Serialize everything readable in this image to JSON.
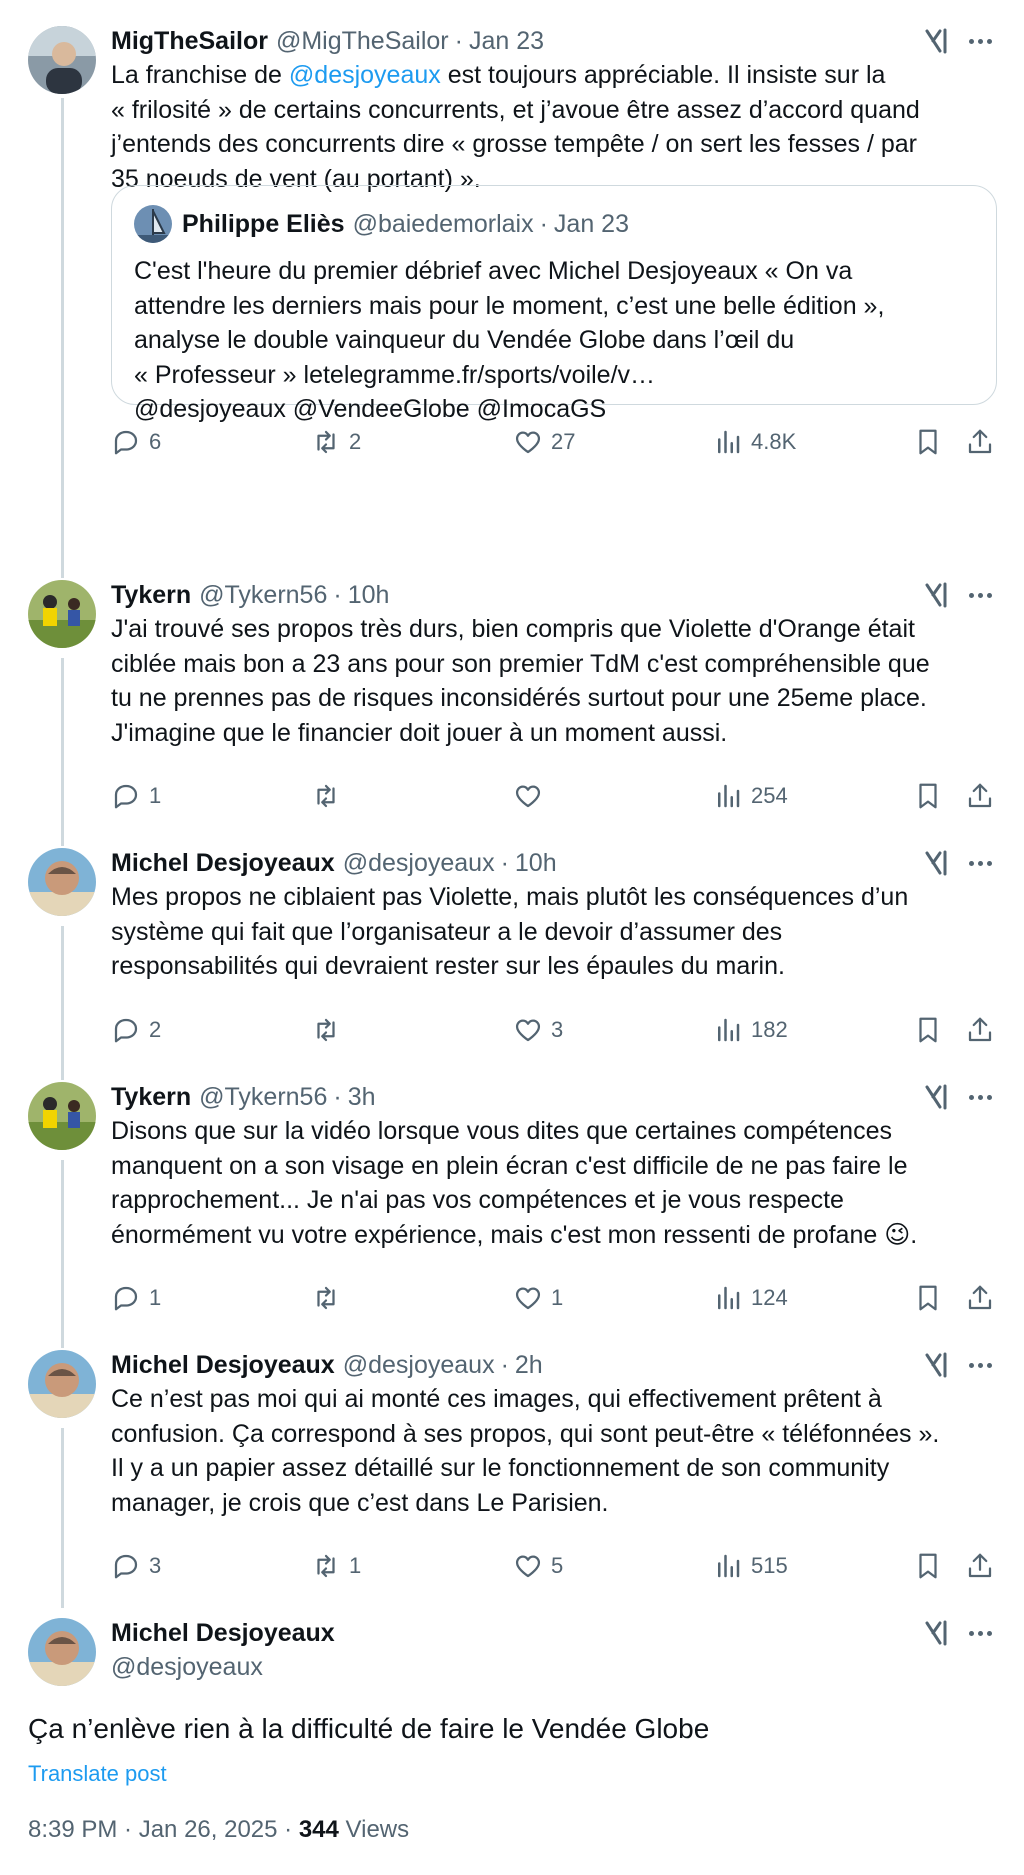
{
  "posts": [
    {
      "name": "MigTheSailor",
      "handle": "@MigTheSailor",
      "time": "Jan 23",
      "body_lines": [
        [
          "La franchise de ",
          "@desjoyeaux",
          " est toujours appréciable. Il insiste sur la"
        ],
        "« frilosité » de certains concurrents, et j’avoue être assez d’accord quand",
        "j’entends des concurrents dire « grosse tempête / on sert les fesses / par",
        "35 noeuds de vent (au portant) »."
      ],
      "quote": {
        "name": "Philippe Eliès",
        "handle": "@baiedemorlaix",
        "time": "Jan 23",
        "lines": [
          "C'est l'heure du premier débrief avec Michel Desjoyeaux « On va",
          "attendre les derniers mais pour le moment, c’est une belle édition »,",
          "analyse le double vainqueur du Vendée Globe dans l’œil du",
          "« Professeur »  letelegramme.fr/sports/voile/v…",
          "@desjoyeaux @VendeeGlobe @ImocaGS"
        ]
      },
      "replies": "6",
      "reposts": "2",
      "likes": "27",
      "views": "4.8K"
    },
    {
      "name": "Tykern",
      "handle": "@Tykern56",
      "time": "10h",
      "body_lines": [
        "J'ai trouvé ses propos très durs, bien compris que Violette d'Orange était",
        "ciblée mais bon a 23 ans pour son premier TdM c'est compréhensible que",
        "tu ne prennes pas de risques inconsidérés surtout pour une 25eme place.",
        "J'imagine que le financier doit jouer à un moment aussi."
      ],
      "replies": "1",
      "reposts": "",
      "likes": "",
      "views": "254"
    },
    {
      "name": "Michel Desjoyeaux",
      "handle": "@desjoyeaux",
      "time": "10h",
      "body_lines": [
        "Mes propos ne ciblaient pas Violette, mais plutôt les conséquences d’un",
        "système qui fait que l’organisateur a le devoir d’assumer des",
        "responsabilités qui devraient rester sur les épaules du marin."
      ],
      "replies": "2",
      "reposts": "",
      "likes": "3",
      "views": "182"
    },
    {
      "name": "Tykern",
      "handle": "@Tykern56",
      "time": "3h",
      "body_lines": [
        "Disons que sur la vidéo lorsque vous dites que certaines compétences",
        "manquent on a son visage en plein écran c'est difficile de ne pas faire le",
        "rapprochement... Je n'ai pas vos compétences et je vous respecte",
        "énormément vu votre expérience, mais c'est mon ressenti de profane 😉."
      ],
      "replies": "1",
      "reposts": "",
      "likes": "1",
      "views": "124"
    },
    {
      "name": "Michel Desjoyeaux",
      "handle": "@desjoyeaux",
      "time": "2h",
      "body_lines": [
        "Ce n’est pas moi qui ai monté ces images, qui effectivement prêtent à",
        "confusion. Ça correspond à ses propos, qui sont peut-être « téléfonnées ».",
        "Il y a un papier assez détaillé sur le fonctionnement de son community",
        "manager, je crois que c’est dans Le Parisien."
      ],
      "replies": "3",
      "reposts": "1",
      "likes": "5",
      "views": "515"
    }
  ],
  "main_post": {
    "name": "Michel Desjoyeaux",
    "handle": "@desjoyeaux",
    "text": "Ça n’enlève rien à la difficulté de faire le Vendée Globe",
    "translate_label": "Translate post",
    "timestamp": "8:39 PM · Jan 26, 2025 · ",
    "views_count": "344",
    "views_label": " Views"
  },
  "icons": {
    "reply": "reply-icon",
    "repost": "repost-icon",
    "like": "heart-icon",
    "views": "views-icon",
    "bookmark": "bookmark-icon",
    "share": "share-icon",
    "grok": "grok-icon",
    "more": "more-icon"
  },
  "colors": {
    "link": "#1d9bf0",
    "secondary": "#536471",
    "thread_line": "#cfd9de"
  }
}
